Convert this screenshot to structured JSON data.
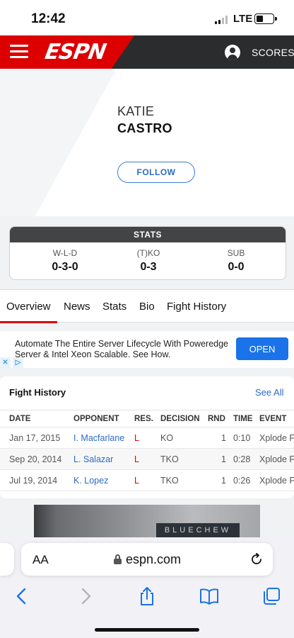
{
  "status_bar": {
    "time": "12:42",
    "network": "LTE"
  },
  "header": {
    "logo": "ESPN",
    "scores_label": "SCORES"
  },
  "profile": {
    "first_name": "KATIE",
    "last_name": "CASTRO",
    "follow_label": "FOLLOW"
  },
  "stats": {
    "title": "STATS",
    "columns": [
      {
        "label": "W-L-D",
        "value": "0-3-0"
      },
      {
        "label": "(T)KO",
        "value": "0-3"
      },
      {
        "label": "SUB",
        "value": "0-0"
      }
    ]
  },
  "tabs": [
    "Overview",
    "News",
    "Stats",
    "Bio",
    "Fight History"
  ],
  "active_tab": "Overview",
  "ad": {
    "text": "Automate The Entire Server Lifecycle With Poweredge Server & Intel Xeon Scalable. See How.",
    "button": "OPEN"
  },
  "fight_history": {
    "title": "Fight History",
    "see_all": "See All",
    "headers": [
      "DATE",
      "OPPONENT",
      "RES.",
      "DECISION",
      "RND",
      "TIME",
      "EVENT"
    ],
    "rows": [
      {
        "date": "Jan 17, 2015",
        "opponent": "I. Macfarlane",
        "result": "L",
        "decision": "KO",
        "round": "1",
        "time": "0:10",
        "event": "Xplode F"
      },
      {
        "date": "Sep 20, 2014",
        "opponent": "L. Salazar",
        "result": "L",
        "decision": "TKO",
        "round": "1",
        "time": "0:28",
        "event": "Xplode F"
      },
      {
        "date": "Jul 19, 2014",
        "opponent": "K. Lopez",
        "result": "L",
        "decision": "TKO",
        "round": "1",
        "time": "0:26",
        "event": "Xplode F"
      }
    ]
  },
  "image_ad": {
    "brand": "BLUECHEW"
  },
  "browser": {
    "aa_label": "AA",
    "url": "espn.com"
  },
  "colors": {
    "espn_red": "#dd0000",
    "link_blue": "#2b6cc4",
    "header_dark": "#2b2c2d"
  }
}
